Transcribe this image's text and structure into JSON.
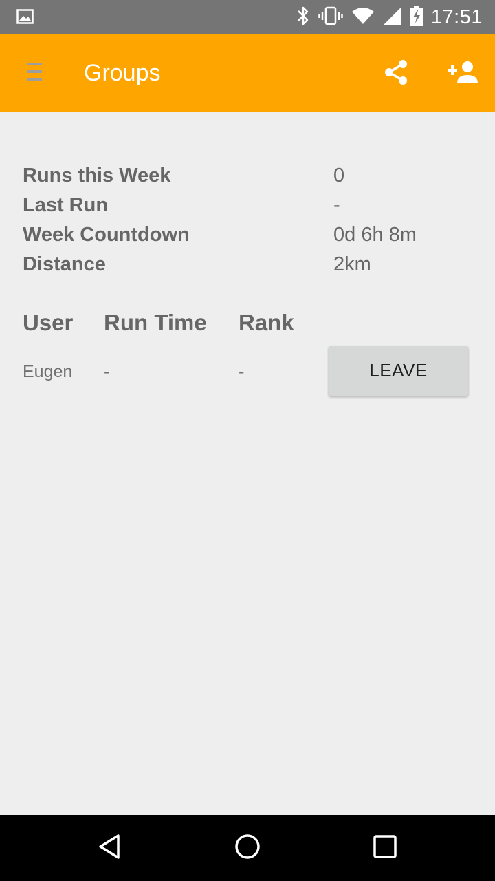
{
  "status_bar": {
    "time": "17:51",
    "icons": [
      "image-icon",
      "bluetooth-icon",
      "vibrate-icon",
      "wifi-icon",
      "signal-icon",
      "battery-charging-icon"
    ]
  },
  "app_bar": {
    "title": "Groups",
    "background_color": "#ffa500",
    "icons": [
      "menu-icon",
      "share-icon",
      "add-user-icon"
    ]
  },
  "stats": [
    {
      "label": "Runs this Week",
      "value": "0"
    },
    {
      "label": "Last Run",
      "value": "-"
    },
    {
      "label": "Week Countdown",
      "value": "0d 6h 8m"
    },
    {
      "label": "Distance",
      "value": "2km"
    }
  ],
  "table": {
    "headers": [
      "User",
      "Run Time",
      "Rank"
    ],
    "rows": [
      {
        "user": "Eugen",
        "run_time": "-",
        "rank": "-",
        "action": "LEAVE"
      }
    ]
  },
  "nav_bar": {
    "icons": [
      "back-icon",
      "home-icon",
      "recents-icon"
    ]
  }
}
